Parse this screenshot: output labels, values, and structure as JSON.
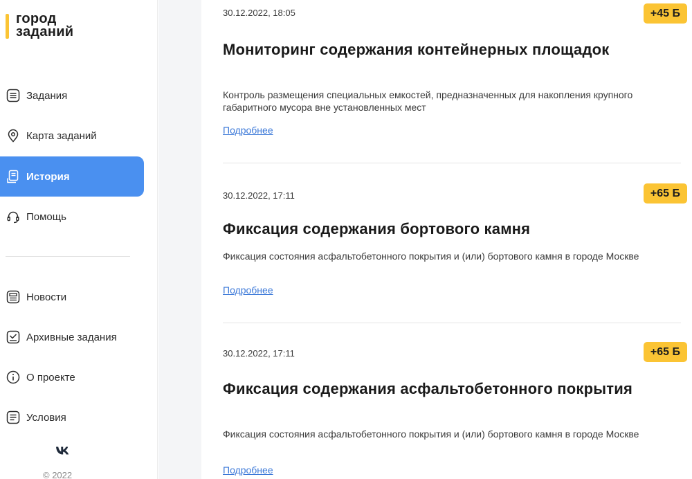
{
  "logo": {
    "line1": "город",
    "line2": "заданий"
  },
  "nav": {
    "primary": [
      {
        "label": "Задания",
        "icon": "list-icon"
      },
      {
        "label": "Карта заданий",
        "icon": "location-pin-icon"
      },
      {
        "label": "История",
        "icon": "history-icon",
        "active": true
      },
      {
        "label": "Помощь",
        "icon": "headset-icon"
      }
    ],
    "secondary": [
      {
        "label": "Новости",
        "icon": "news-icon"
      },
      {
        "label": "Архивные задания",
        "icon": "archive-check-icon"
      },
      {
        "label": "О проекте",
        "icon": "info-icon"
      },
      {
        "label": "Условия",
        "icon": "document-icon"
      }
    ]
  },
  "footer": {
    "copyright": "© 2022",
    "social_icon": "vk-icon"
  },
  "tasks": [
    {
      "date": "30.12.2022, 18:05",
      "points": "+45 Б",
      "title": "Мониторинг содержания контейнерных площадок",
      "description": "Контроль размещения специальных емкостей, предназначенных для накопления крупного габаритного мусора вне установленных мест",
      "link": "Подробнее"
    },
    {
      "date": "30.12.2022, 17:11",
      "points": "+65 Б",
      "title": "Фиксация содержания бортового камня",
      "description": "Фиксация состояния асфальтобетонного покрытия и (или) бортового камня в городе Москве",
      "link": "Подробнее"
    },
    {
      "date": "30.12.2022, 17:11",
      "points": "+65 Б",
      "title": "Фиксация содержания асфальтобетонного покрытия",
      "description": "Фиксация состояния асфальтобетонного покрытия и (или) бортового камня в городе Москве",
      "link": "Подробнее"
    }
  ],
  "colors": {
    "accent": "#4a90f0",
    "badge": "#fbc434",
    "link": "#3b78d8"
  }
}
